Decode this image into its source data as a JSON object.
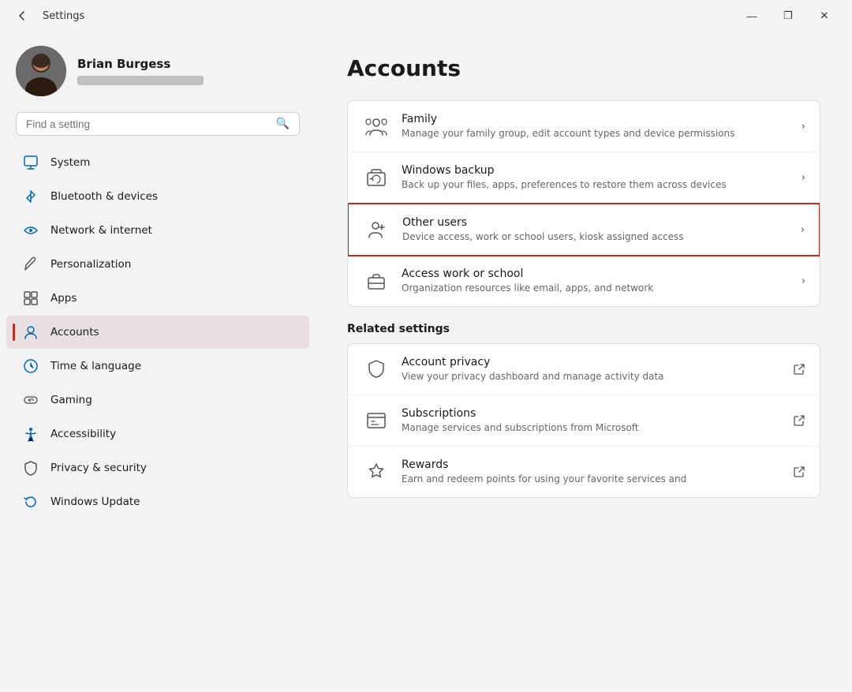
{
  "titleBar": {
    "appTitle": "Settings",
    "backBtn": "←",
    "minBtn": "—",
    "maxBtn": "❐",
    "closeBtn": "✕"
  },
  "user": {
    "name": "Brian Burgess",
    "emailPlaceholder": "••••••••••••••"
  },
  "search": {
    "placeholder": "Find a setting"
  },
  "navItems": [
    {
      "id": "system",
      "label": "System",
      "active": false
    },
    {
      "id": "bluetooth",
      "label": "Bluetooth & devices",
      "active": false
    },
    {
      "id": "network",
      "label": "Network & internet",
      "active": false
    },
    {
      "id": "personalization",
      "label": "Personalization",
      "active": false
    },
    {
      "id": "apps",
      "label": "Apps",
      "active": false
    },
    {
      "id": "accounts",
      "label": "Accounts",
      "active": true
    },
    {
      "id": "time",
      "label": "Time & language",
      "active": false
    },
    {
      "id": "gaming",
      "label": "Gaming",
      "active": false
    },
    {
      "id": "accessibility",
      "label": "Accessibility",
      "active": false
    },
    {
      "id": "privacy",
      "label": "Privacy & security",
      "active": false
    },
    {
      "id": "update",
      "label": "Windows Update",
      "active": false
    }
  ],
  "pageTitle": "Accounts",
  "settingsItems": [
    {
      "id": "family",
      "title": "Family",
      "desc": "Manage your family group, edit account types and device permissions",
      "type": "arrow",
      "highlighted": false
    },
    {
      "id": "windows-backup",
      "title": "Windows backup",
      "desc": "Back up your files, apps, preferences to restore them across devices",
      "type": "arrow",
      "highlighted": false
    },
    {
      "id": "other-users",
      "title": "Other users",
      "desc": "Device access, work or school users, kiosk assigned access",
      "type": "arrow",
      "highlighted": true
    },
    {
      "id": "access-work",
      "title": "Access work or school",
      "desc": "Organization resources like email, apps, and network",
      "type": "arrow",
      "highlighted": false
    }
  ],
  "relatedSettings": {
    "label": "Related settings",
    "items": [
      {
        "id": "account-privacy",
        "title": "Account privacy",
        "desc": "View your privacy dashboard and manage activity data",
        "type": "external"
      },
      {
        "id": "subscriptions",
        "title": "Subscriptions",
        "desc": "Manage services and subscriptions from Microsoft",
        "type": "external"
      },
      {
        "id": "rewards",
        "title": "Rewards",
        "desc": "Earn and redeem points for using your favorite services and",
        "type": "external"
      }
    ]
  }
}
